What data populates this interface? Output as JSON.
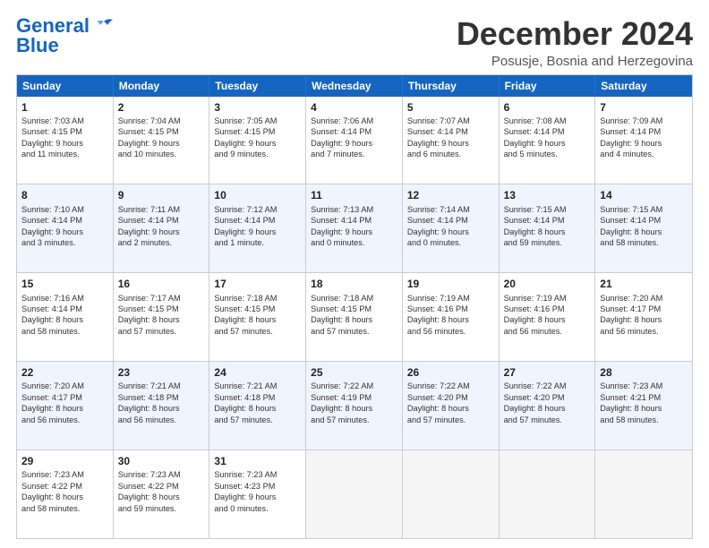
{
  "logo": {
    "line1": "General",
    "line2": "Blue"
  },
  "title": "December 2024",
  "subtitle": "Posusje, Bosnia and Herzegovina",
  "header_days": [
    "Sunday",
    "Monday",
    "Tuesday",
    "Wednesday",
    "Thursday",
    "Friday",
    "Saturday"
  ],
  "weeks": [
    [
      {
        "day": "1",
        "lines": [
          "Sunrise: 7:03 AM",
          "Sunset: 4:15 PM",
          "Daylight: 9 hours",
          "and 11 minutes."
        ]
      },
      {
        "day": "2",
        "lines": [
          "Sunrise: 7:04 AM",
          "Sunset: 4:15 PM",
          "Daylight: 9 hours",
          "and 10 minutes."
        ]
      },
      {
        "day": "3",
        "lines": [
          "Sunrise: 7:05 AM",
          "Sunset: 4:15 PM",
          "Daylight: 9 hours",
          "and 9 minutes."
        ]
      },
      {
        "day": "4",
        "lines": [
          "Sunrise: 7:06 AM",
          "Sunset: 4:14 PM",
          "Daylight: 9 hours",
          "and 7 minutes."
        ]
      },
      {
        "day": "5",
        "lines": [
          "Sunrise: 7:07 AM",
          "Sunset: 4:14 PM",
          "Daylight: 9 hours",
          "and 6 minutes."
        ]
      },
      {
        "day": "6",
        "lines": [
          "Sunrise: 7:08 AM",
          "Sunset: 4:14 PM",
          "Daylight: 9 hours",
          "and 5 minutes."
        ]
      },
      {
        "day": "7",
        "lines": [
          "Sunrise: 7:09 AM",
          "Sunset: 4:14 PM",
          "Daylight: 9 hours",
          "and 4 minutes."
        ]
      }
    ],
    [
      {
        "day": "8",
        "lines": [
          "Sunrise: 7:10 AM",
          "Sunset: 4:14 PM",
          "Daylight: 9 hours",
          "and 3 minutes."
        ]
      },
      {
        "day": "9",
        "lines": [
          "Sunrise: 7:11 AM",
          "Sunset: 4:14 PM",
          "Daylight: 9 hours",
          "and 2 minutes."
        ]
      },
      {
        "day": "10",
        "lines": [
          "Sunrise: 7:12 AM",
          "Sunset: 4:14 PM",
          "Daylight: 9 hours",
          "and 1 minute."
        ]
      },
      {
        "day": "11",
        "lines": [
          "Sunrise: 7:13 AM",
          "Sunset: 4:14 PM",
          "Daylight: 9 hours",
          "and 0 minutes."
        ]
      },
      {
        "day": "12",
        "lines": [
          "Sunrise: 7:14 AM",
          "Sunset: 4:14 PM",
          "Daylight: 9 hours",
          "and 0 minutes."
        ]
      },
      {
        "day": "13",
        "lines": [
          "Sunrise: 7:15 AM",
          "Sunset: 4:14 PM",
          "Daylight: 8 hours",
          "and 59 minutes."
        ]
      },
      {
        "day": "14",
        "lines": [
          "Sunrise: 7:15 AM",
          "Sunset: 4:14 PM",
          "Daylight: 8 hours",
          "and 58 minutes."
        ]
      }
    ],
    [
      {
        "day": "15",
        "lines": [
          "Sunrise: 7:16 AM",
          "Sunset: 4:14 PM",
          "Daylight: 8 hours",
          "and 58 minutes."
        ]
      },
      {
        "day": "16",
        "lines": [
          "Sunrise: 7:17 AM",
          "Sunset: 4:15 PM",
          "Daylight: 8 hours",
          "and 57 minutes."
        ]
      },
      {
        "day": "17",
        "lines": [
          "Sunrise: 7:18 AM",
          "Sunset: 4:15 PM",
          "Daylight: 8 hours",
          "and 57 minutes."
        ]
      },
      {
        "day": "18",
        "lines": [
          "Sunrise: 7:18 AM",
          "Sunset: 4:15 PM",
          "Daylight: 8 hours",
          "and 57 minutes."
        ]
      },
      {
        "day": "19",
        "lines": [
          "Sunrise: 7:19 AM",
          "Sunset: 4:16 PM",
          "Daylight: 8 hours",
          "and 56 minutes."
        ]
      },
      {
        "day": "20",
        "lines": [
          "Sunrise: 7:19 AM",
          "Sunset: 4:16 PM",
          "Daylight: 8 hours",
          "and 56 minutes."
        ]
      },
      {
        "day": "21",
        "lines": [
          "Sunrise: 7:20 AM",
          "Sunset: 4:17 PM",
          "Daylight: 8 hours",
          "and 56 minutes."
        ]
      }
    ],
    [
      {
        "day": "22",
        "lines": [
          "Sunrise: 7:20 AM",
          "Sunset: 4:17 PM",
          "Daylight: 8 hours",
          "and 56 minutes."
        ]
      },
      {
        "day": "23",
        "lines": [
          "Sunrise: 7:21 AM",
          "Sunset: 4:18 PM",
          "Daylight: 8 hours",
          "and 56 minutes."
        ]
      },
      {
        "day": "24",
        "lines": [
          "Sunrise: 7:21 AM",
          "Sunset: 4:18 PM",
          "Daylight: 8 hours",
          "and 57 minutes."
        ]
      },
      {
        "day": "25",
        "lines": [
          "Sunrise: 7:22 AM",
          "Sunset: 4:19 PM",
          "Daylight: 8 hours",
          "and 57 minutes."
        ]
      },
      {
        "day": "26",
        "lines": [
          "Sunrise: 7:22 AM",
          "Sunset: 4:20 PM",
          "Daylight: 8 hours",
          "and 57 minutes."
        ]
      },
      {
        "day": "27",
        "lines": [
          "Sunrise: 7:22 AM",
          "Sunset: 4:20 PM",
          "Daylight: 8 hours",
          "and 57 minutes."
        ]
      },
      {
        "day": "28",
        "lines": [
          "Sunrise: 7:23 AM",
          "Sunset: 4:21 PM",
          "Daylight: 8 hours",
          "and 58 minutes."
        ]
      }
    ],
    [
      {
        "day": "29",
        "lines": [
          "Sunrise: 7:23 AM",
          "Sunset: 4:22 PM",
          "Daylight: 8 hours",
          "and 58 minutes."
        ]
      },
      {
        "day": "30",
        "lines": [
          "Sunrise: 7:23 AM",
          "Sunset: 4:22 PM",
          "Daylight: 8 hours",
          "and 59 minutes."
        ]
      },
      {
        "day": "31",
        "lines": [
          "Sunrise: 7:23 AM",
          "Sunset: 4:23 PM",
          "Daylight: 9 hours",
          "and 0 minutes."
        ]
      },
      {
        "day": "",
        "lines": []
      },
      {
        "day": "",
        "lines": []
      },
      {
        "day": "",
        "lines": []
      },
      {
        "day": "",
        "lines": []
      }
    ]
  ]
}
